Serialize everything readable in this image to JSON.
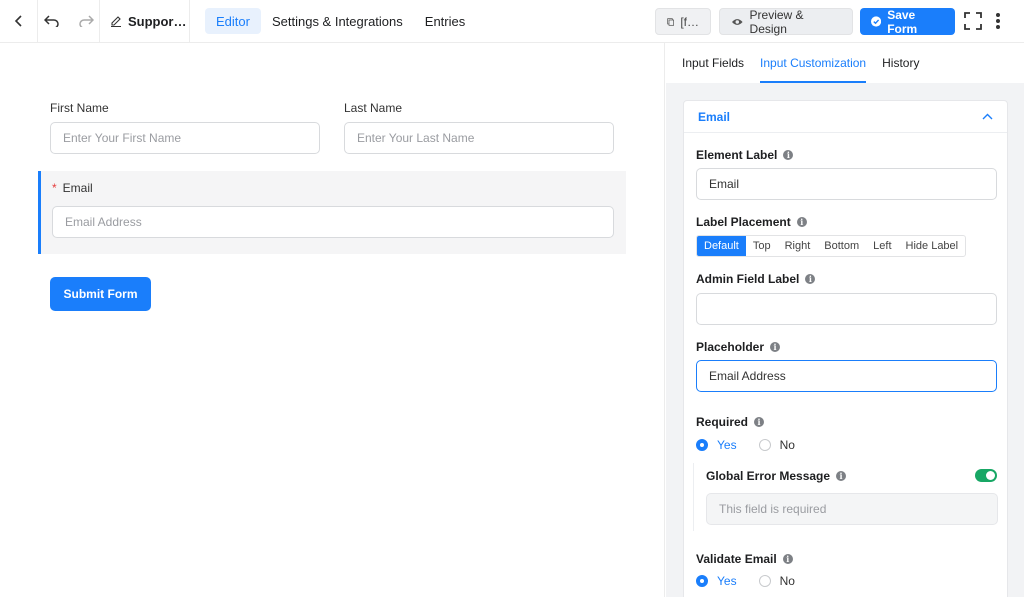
{
  "topbar": {
    "form_title": "Suppor…",
    "tabs": [
      "Editor",
      "Settings & Integrations",
      "Entries"
    ],
    "shortcode_label": "[f…",
    "preview_label": "Preview & Design",
    "save_label": "Save Form"
  },
  "form": {
    "first_name_label": "First Name",
    "first_name_placeholder": "Enter Your First Name",
    "last_name_label": "Last Name",
    "last_name_placeholder": "Enter Your Last Name",
    "email_required_mark": "*",
    "email_label": "Email",
    "email_placeholder": "Email Address",
    "submit_label": "Submit Form"
  },
  "sidebar": {
    "tabs": [
      "Input Fields",
      "Input Customization",
      "History"
    ],
    "panel_title": "Email",
    "element_label": {
      "label": "Element Label",
      "value": "Email"
    },
    "label_placement": {
      "label": "Label Placement",
      "options": [
        "Default",
        "Top",
        "Right",
        "Bottom",
        "Left",
        "Hide Label"
      ],
      "selected": "Default"
    },
    "admin_field_label": {
      "label": "Admin Field Label",
      "value": ""
    },
    "placeholder": {
      "label": "Placeholder",
      "value": "Email Address"
    },
    "required": {
      "label": "Required",
      "yes": "Yes",
      "no": "No",
      "selected": "Yes"
    },
    "global_error": {
      "label": "Global Error Message",
      "enabled": true,
      "placeholder": "This field is required"
    },
    "validate_email": {
      "label": "Validate Email",
      "yes": "Yes",
      "no": "No",
      "selected": "Yes"
    }
  },
  "colors": {
    "accent": "#1a7efb",
    "toggle_on": "#18a765",
    "required": "#e53e3e"
  }
}
